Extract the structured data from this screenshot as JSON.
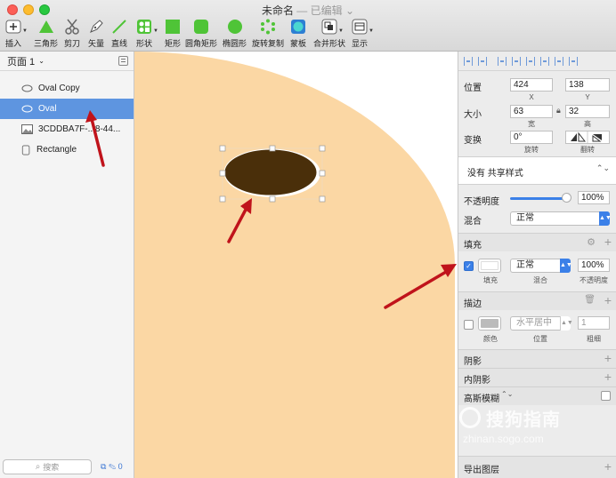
{
  "window": {
    "title": "未命名",
    "title_suffix": "— 已编辑"
  },
  "toolbar": {
    "insert": "插入",
    "triangle": "三角形",
    "scissors": "剪刀",
    "vector": "矢量",
    "line": "直线",
    "shape": "形状",
    "rect": "矩形",
    "rounded_rect": "圆角矩形",
    "oval": "椭圆形",
    "rotate_copy": "旋转复制",
    "mask": "蒙板",
    "combine": "合并形状",
    "display": "显示"
  },
  "sidebar": {
    "page_label": "页面 1",
    "layers": [
      {
        "name": "Oval Copy",
        "selected": false
      },
      {
        "name": "Oval",
        "selected": true
      },
      {
        "name": "3CDDBA7F-...8-44...",
        "selected": false
      },
      {
        "name": "Rectangle",
        "selected": false
      }
    ],
    "search_placeholder": "搜索",
    "filter_count": "0"
  },
  "inspector": {
    "position": {
      "label": "位置",
      "x": "424",
      "y": "138",
      "x_label": "X",
      "y_label": "Y"
    },
    "size": {
      "label": "大小",
      "w": "63",
      "h": "32",
      "w_label": "宽",
      "h_label": "高"
    },
    "transform": {
      "label": "变换",
      "rotate": "0°",
      "rotate_label": "旋转",
      "flip_label": "翻转"
    },
    "shared_style": "没有 共享样式",
    "opacity": {
      "label": "不透明度",
      "value": "100%",
      "slider_fraction": 1.0
    },
    "blend": {
      "label": "混合",
      "value": "正常"
    },
    "fill": {
      "title": "填充",
      "enabled": true,
      "color": "#ffffff",
      "mode": "正常",
      "opacity": "100%",
      "sub_fill": "填充",
      "sub_blend": "混合",
      "sub_opacity": "不透明度"
    },
    "border": {
      "title": "描边",
      "enabled": false,
      "color": "#bbbbbb",
      "position": "水平居中",
      "thickness": "1",
      "sub_color": "颜色",
      "sub_position": "位置",
      "sub_thickness": "粗细"
    },
    "shadow": "阴影",
    "inner_shadow": "内阴影",
    "gaussian_blur": "高斯模糊",
    "export": "导出图层"
  },
  "canvas": {
    "artboard_color": "#fbd7a4",
    "oval_fill": "#4a2f0a",
    "oval_stroke": "#ffffff"
  },
  "watermark": {
    "brand": "搜狗指南",
    "url": "zhinan.sogo.com"
  }
}
